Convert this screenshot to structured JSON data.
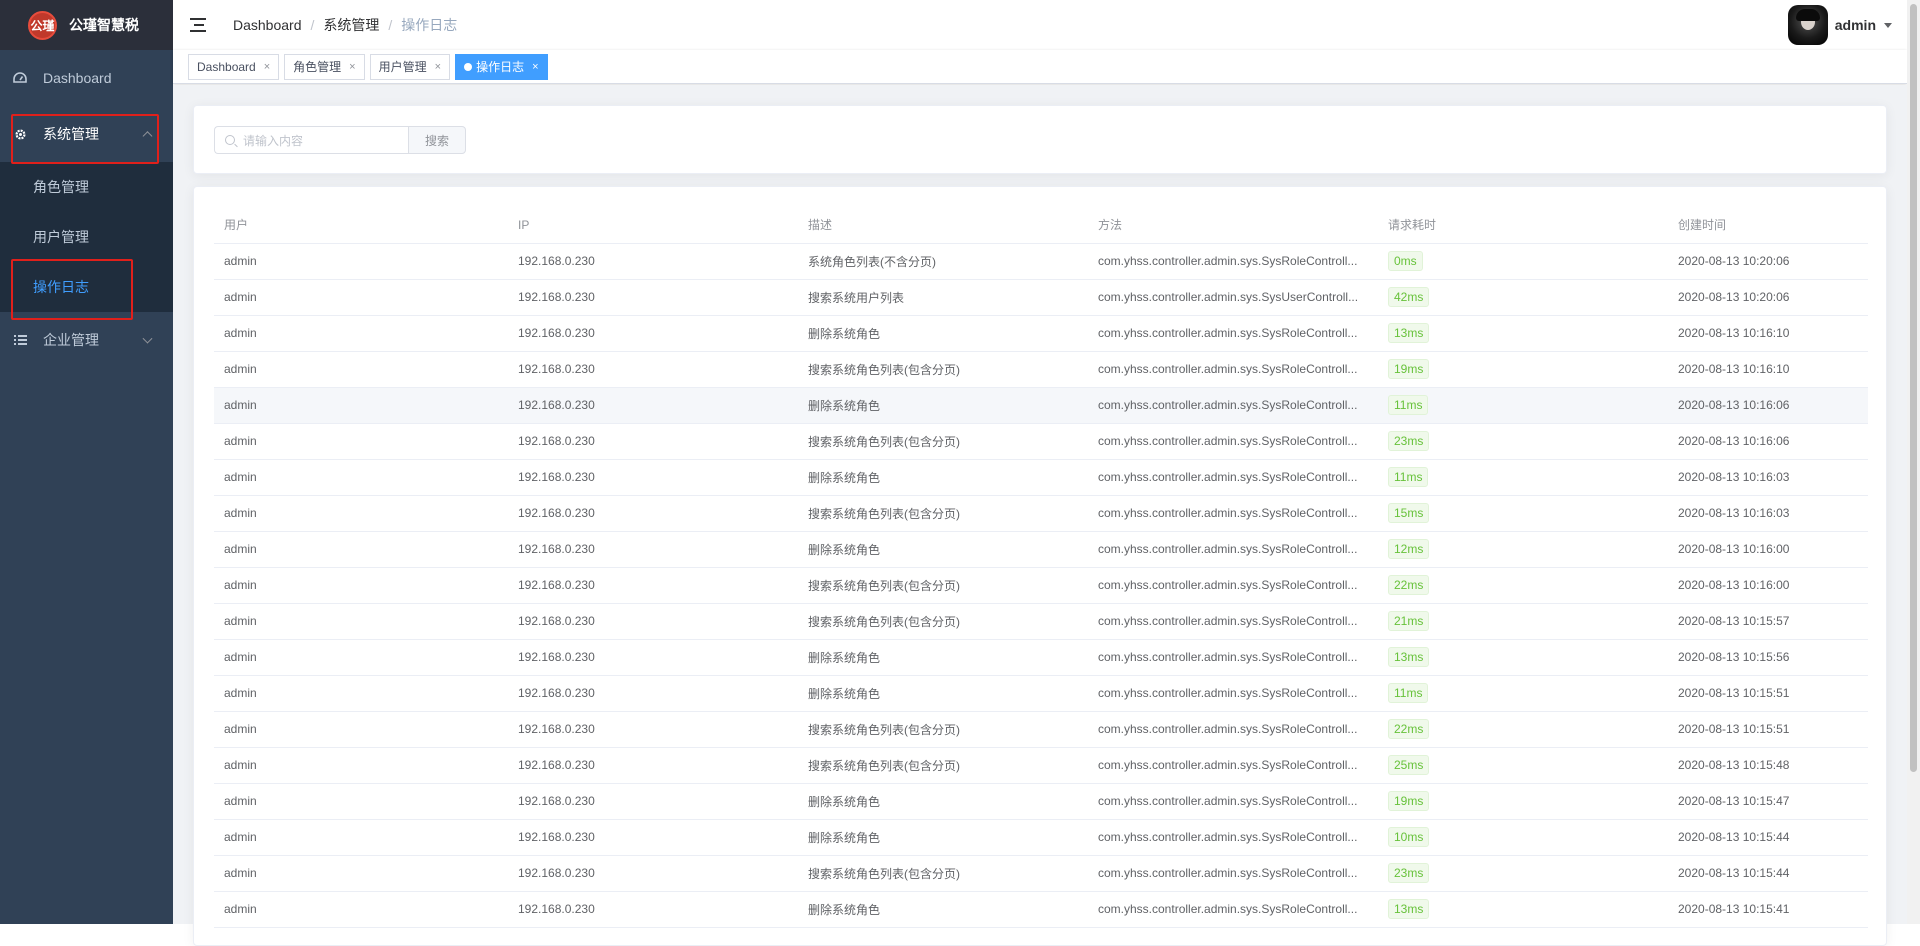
{
  "app": {
    "logo_mark": "公瑾",
    "title": "公瑾智慧税"
  },
  "sidebar": {
    "items": [
      {
        "label": "Dashboard",
        "icon": "dashboard-icon"
      },
      {
        "label": "系统管理",
        "icon": "gear-icon",
        "expanded": true,
        "children": [
          {
            "label": "角色管理"
          },
          {
            "label": "用户管理"
          },
          {
            "label": "操作日志",
            "active": true
          }
        ]
      },
      {
        "label": "企业管理",
        "icon": "list-icon",
        "expanded": false
      }
    ]
  },
  "breadcrumb": [
    "Dashboard",
    "系统管理",
    "操作日志"
  ],
  "user": {
    "name": "admin"
  },
  "tags": [
    {
      "label": "Dashboard",
      "close": "×"
    },
    {
      "label": "角色管理",
      "close": "×"
    },
    {
      "label": "用户管理",
      "close": "×"
    },
    {
      "label": "操作日志",
      "close": "×",
      "active": true
    }
  ],
  "search": {
    "placeholder": "请输入内容",
    "button_label": "搜索"
  },
  "table": {
    "columns": [
      "用户",
      "IP",
      "描述",
      "方法",
      "请求耗时",
      "创建时间"
    ],
    "rows": [
      [
        "admin",
        "192.168.0.230",
        "系统角色列表(不含分页)",
        "com.yhss.controller.admin.sys.SysRoleControll...",
        "0ms",
        "2020-08-13 10:20:06"
      ],
      [
        "admin",
        "192.168.0.230",
        "搜索系统用户列表",
        "com.yhss.controller.admin.sys.SysUserControll...",
        "42ms",
        "2020-08-13 10:20:06"
      ],
      [
        "admin",
        "192.168.0.230",
        "删除系统角色",
        "com.yhss.controller.admin.sys.SysRoleControll...",
        "13ms",
        "2020-08-13 10:16:10"
      ],
      [
        "admin",
        "192.168.0.230",
        "搜索系统角色列表(包含分页)",
        "com.yhss.controller.admin.sys.SysRoleControll...",
        "19ms",
        "2020-08-13 10:16:10"
      ],
      [
        "admin",
        "192.168.0.230",
        "删除系统角色",
        "com.yhss.controller.admin.sys.SysRoleControll...",
        "11ms",
        "2020-08-13 10:16:06"
      ],
      [
        "admin",
        "192.168.0.230",
        "搜索系统角色列表(包含分页)",
        "com.yhss.controller.admin.sys.SysRoleControll...",
        "23ms",
        "2020-08-13 10:16:06"
      ],
      [
        "admin",
        "192.168.0.230",
        "删除系统角色",
        "com.yhss.controller.admin.sys.SysRoleControll...",
        "11ms",
        "2020-08-13 10:16:03"
      ],
      [
        "admin",
        "192.168.0.230",
        "搜索系统角色列表(包含分页)",
        "com.yhss.controller.admin.sys.SysRoleControll...",
        "15ms",
        "2020-08-13 10:16:03"
      ],
      [
        "admin",
        "192.168.0.230",
        "删除系统角色",
        "com.yhss.controller.admin.sys.SysRoleControll...",
        "12ms",
        "2020-08-13 10:16:00"
      ],
      [
        "admin",
        "192.168.0.230",
        "搜索系统角色列表(包含分页)",
        "com.yhss.controller.admin.sys.SysRoleControll...",
        "22ms",
        "2020-08-13 10:16:00"
      ],
      [
        "admin",
        "192.168.0.230",
        "搜索系统角色列表(包含分页)",
        "com.yhss.controller.admin.sys.SysRoleControll...",
        "21ms",
        "2020-08-13 10:15:57"
      ],
      [
        "admin",
        "192.168.0.230",
        "删除系统角色",
        "com.yhss.controller.admin.sys.SysRoleControll...",
        "13ms",
        "2020-08-13 10:15:56"
      ],
      [
        "admin",
        "192.168.0.230",
        "删除系统角色",
        "com.yhss.controller.admin.sys.SysRoleControll...",
        "11ms",
        "2020-08-13 10:15:51"
      ],
      [
        "admin",
        "192.168.0.230",
        "搜索系统角色列表(包含分页)",
        "com.yhss.controller.admin.sys.SysRoleControll...",
        "22ms",
        "2020-08-13 10:15:51"
      ],
      [
        "admin",
        "192.168.0.230",
        "搜索系统角色列表(包含分页)",
        "com.yhss.controller.admin.sys.SysRoleControll...",
        "25ms",
        "2020-08-13 10:15:48"
      ],
      [
        "admin",
        "192.168.0.230",
        "删除系统角色",
        "com.yhss.controller.admin.sys.SysRoleControll...",
        "19ms",
        "2020-08-13 10:15:47"
      ],
      [
        "admin",
        "192.168.0.230",
        "删除系统角色",
        "com.yhss.controller.admin.sys.SysRoleControll...",
        "10ms",
        "2020-08-13 10:15:44"
      ],
      [
        "admin",
        "192.168.0.230",
        "搜索系统角色列表(包含分页)",
        "com.yhss.controller.admin.sys.SysRoleControll...",
        "23ms",
        "2020-08-13 10:15:44"
      ],
      [
        "admin",
        "192.168.0.230",
        "删除系统角色",
        "com.yhss.controller.admin.sys.SysRoleControll...",
        "13ms",
        "2020-08-13 10:15:41"
      ]
    ]
  },
  "colors": {
    "sidebar_bg": "#304156",
    "submenu_bg": "#1f2d3d",
    "accent": "#409eff",
    "success_tag": "#67c23a",
    "highlight_box": "#e0201b"
  }
}
